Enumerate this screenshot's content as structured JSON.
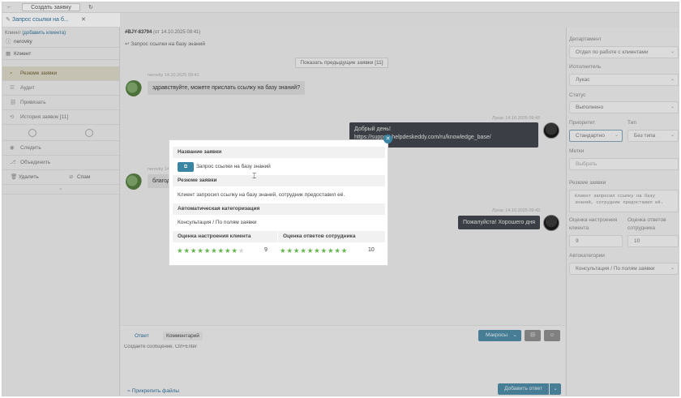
{
  "topbar": {
    "back": "←",
    "forward": "→",
    "create_label": "Создать заявку",
    "refresh": "↻"
  },
  "tab": {
    "label": "Запрос ссылки на б...",
    "close": "✕"
  },
  "sidebar": {
    "client_label": "Клиент",
    "client_add": "(добавить клиента)",
    "client_name": "nerovky",
    "client_type": "Клиент",
    "menu": [
      {
        "icon": "search-icon",
        "glyph": "⌕",
        "label": "Резюме заявки",
        "active": true
      },
      {
        "icon": "audit-icon",
        "glyph": "☰",
        "label": "Аудит",
        "active": false
      },
      {
        "icon": "link-icon",
        "glyph": "⛓",
        "label": "Привязать",
        "active": false
      },
      {
        "icon": "history-icon",
        "glyph": "⟲",
        "label": "История заявок [11]",
        "active": false
      }
    ],
    "follow": "Следить",
    "merge": "Объединить",
    "delete": "Удалить",
    "spam": "Спам",
    "more": "⌄"
  },
  "chat": {
    "ticket_id": "#BJY-83794",
    "ticket_date": "(от 14.10.2025 09:41)",
    "ticket_subject": "Запрос ссылки на базу знаний",
    "prev_button": "Показать предыдущие заявки [11]",
    "messages": [
      {
        "meta": "nerovky 14.10.2025 09:41",
        "text": "здравствуйте, можете прислать ссылку на базу знаний?"
      },
      {
        "meta": "Лукас 14.10.2025 09:43",
        "text": "Добрый день!",
        "text2": "https://support.helpdeskeddy.com/ru/knowledge_base/"
      },
      {
        "meta": "nerovky 14.",
        "text": "благод"
      },
      {
        "meta": "Лукас 14.10.2025 09:43",
        "text": "Пожалуйста! Хорошего дня"
      }
    ]
  },
  "composer": {
    "tab_answer": "Ответ",
    "tab_comment": "Комментарий",
    "macros": "Макросы",
    "placeholder": "Создайте сообщение. Ctrl+Enter",
    "attach": "Прикрепить файлы",
    "send": "Добавить ответ"
  },
  "right": {
    "department_label": "Департамент",
    "department": "Отдел по работе с клиентами",
    "assignee_label": "Исполнитель",
    "assignee": "Лукас",
    "status_label": "Статус",
    "status": "Выполнено",
    "priority_label": "Приоритет",
    "priority": "Стандартно",
    "type_label": "Тип",
    "type": "Без типа",
    "tags_label": "Метки",
    "tags_placeholder": "Выбрать",
    "summary_label": "Резюме заявки",
    "summary": "Клиент запросил ссылку на базу знаний, сотрудник предоставил её.",
    "mood_label": "Оценка настроения клиента",
    "mood_value": "9",
    "staff_label": "Оценка ответов сотрудника",
    "staff_value": "10",
    "autocat_label": "Автокатегории",
    "autocat": "Консультация / По полям заявки"
  },
  "modal": {
    "title_section": "Название заявки",
    "title_value": "Запрос ссылки на базу знаний",
    "summary_section": "Резюме заявки",
    "summary_value": "Клиент запросил ссылку на базу знаний, сотрудник предоставил её.",
    "autocat_section": "Автоматическая категоризация",
    "autocat_value": "Консультация / По полям заявки",
    "mood_section": "Оценка настроения клиента",
    "staff_section": "Оценка ответов сотрудника",
    "mood_score": 9,
    "staff_score": 10,
    "stars_max": 10,
    "close": "✕"
  },
  "colors": {
    "accent": "#3a84a4",
    "star": "#62b548",
    "active_menu": "#dcd8c7"
  }
}
